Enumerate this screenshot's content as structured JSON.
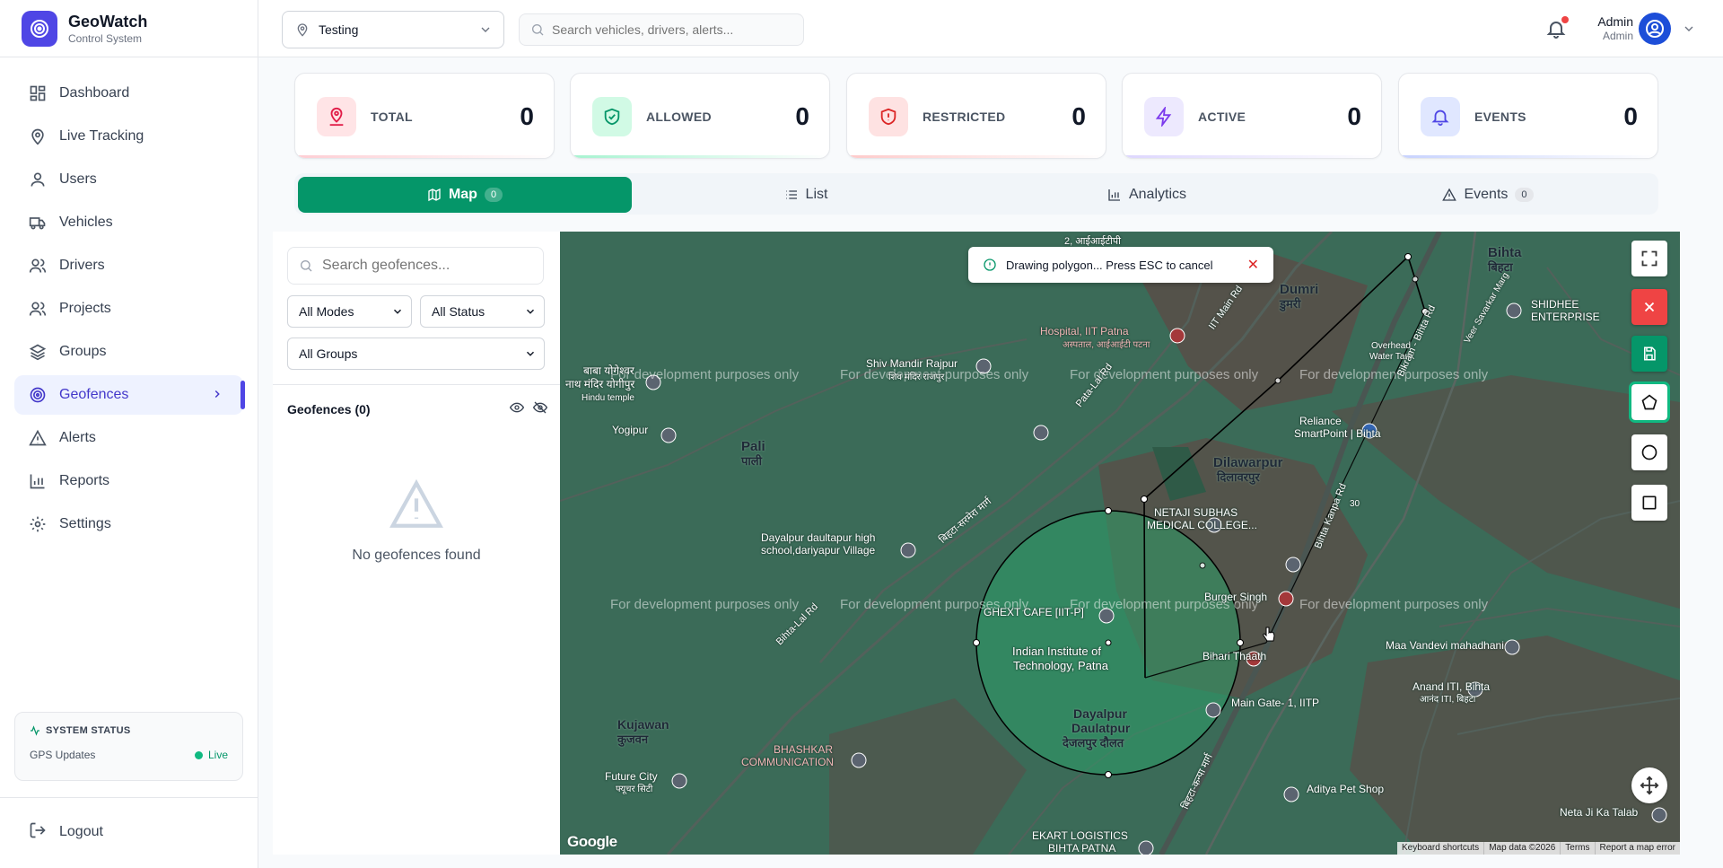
{
  "brand": {
    "name": "GeoWatch",
    "subtitle": "Control System"
  },
  "sidebar": {
    "items": [
      {
        "label": "Dashboard",
        "icon": "dashboard-icon"
      },
      {
        "label": "Live Tracking",
        "icon": "map-pin-icon"
      },
      {
        "label": "Users",
        "icon": "user-icon"
      },
      {
        "label": "Vehicles",
        "icon": "truck-icon"
      },
      {
        "label": "Drivers",
        "icon": "users-icon"
      },
      {
        "label": "Projects",
        "icon": "users-icon"
      },
      {
        "label": "Groups",
        "icon": "layers-icon"
      },
      {
        "label": "Geofences",
        "icon": "target-icon",
        "active": true
      },
      {
        "label": "Alerts",
        "icon": "warning-icon"
      },
      {
        "label": "Reports",
        "icon": "bar-chart-icon"
      },
      {
        "label": "Settings",
        "icon": "gear-icon"
      }
    ],
    "system_status": {
      "title": "SYSTEM STATUS",
      "label": "GPS Updates",
      "value": "Live"
    },
    "logout": "Logout"
  },
  "header": {
    "project": "Testing",
    "search_placeholder": "Search vehicles, drivers, alerts...",
    "user": {
      "name": "Admin",
      "role": "Admin"
    }
  },
  "stats": [
    {
      "label": "TOTAL",
      "value": "0",
      "color": "#e11d48"
    },
    {
      "label": "ALLOWED",
      "value": "0",
      "color": "#059669"
    },
    {
      "label": "RESTRICTED",
      "value": "0",
      "color": "#dc2626"
    },
    {
      "label": "ACTIVE",
      "value": "0",
      "color": "#7c3aed"
    },
    {
      "label": "EVENTS",
      "value": "0",
      "color": "#4f46e5"
    }
  ],
  "tabs": [
    {
      "label": "Map",
      "count": "0",
      "active": true
    },
    {
      "label": "List"
    },
    {
      "label": "Analytics"
    },
    {
      "label": "Events",
      "count": "0"
    }
  ],
  "panel": {
    "search_placeholder": "Search geofences...",
    "mode_filter": "All Modes",
    "status_filter": "All Status",
    "group_filter": "All Groups",
    "geofences_header": "Geofences (0)",
    "empty_text": "No geofences found"
  },
  "map": {
    "toast": "Drawing polygon... Press ESC to cancel",
    "watermark": "For development purposes only",
    "labels": {
      "bihta": "Bihta",
      "bihta_hi": "बिहटा",
      "dumri": "Dumri",
      "dumri_hi": "डुमरी",
      "hospital": "Hospital, IIT Patna",
      "hospital_hi": "अस्पताल, आईआईटी पटना",
      "shiv_mandir": "Shiv Mandir Rajpur",
      "shiv_mandir_hi": "शिव मंदिर राजपुर",
      "baba": "बाबा योगेश्वर",
      "baba2": "नाथ मंदिर योगीपुर",
      "yogipur": "Yogipur",
      "yogipur_hi": "Hindu temple",
      "pali": "Pali",
      "pali_hi": "पाली",
      "dilawarpur": "Dilawarpur",
      "dilawarpur_hi": "दिलावरपुर",
      "netaji": "NETAJI SUBHAS",
      "netaji2": "MEDICAL COLLEGE...",
      "dayalpur_school": "Dayalpur daultapur high",
      "dayalpur_school2": "school,dariyapur Village",
      "ghext": "GHEXT CAFE [IIT-P]",
      "iit": "Indian Institute of",
      "iit2": "Technology, Patna",
      "dayalpur": "Dayalpur",
      "dayalpur2": "Daulatpur",
      "dayalpur_hi": "देजलपुर दौलत",
      "bihari_thaath": "Bihari Thaath",
      "burger": "Burger Singh",
      "main_gate": "Main Gate- 1, IITP",
      "kujawan": "Kujawan",
      "kujawan_hi": "कुजवन",
      "bhashkar": "BHASHKAR",
      "bhashkar2": "COMMUNICATION",
      "future_city": "Future City",
      "future_city_hi": "फ्यूचर सिटी",
      "ekart": "EKART LOGISTICS",
      "ekart2": "BIHTA PATNA",
      "aditya": "Aditya Pet Shop",
      "maa": "Maa Vandevi mahadhani",
      "anand": "Anand ITI, Bihta",
      "anand_hi": "आनंद ITI, बिहटा",
      "neta": "Neta Ji Ka Talab",
      "reliance": "Reliance",
      "smartpoint": "SmartPoint | Bihta",
      "shidhee": "SHIDHEE",
      "shidhee2": "ENTERPRISE",
      "overhead": "Overhead",
      "overhead2": "Water Tank",
      "iit_main": "IIT Main Rd",
      "patna_lal": "Pata-Lal Rd",
      "bihta_road": "बिहटा-सरमेरा मार्ग",
      "bikram": "Bikram - Bihta Rd",
      "bihta_kanpa": "Bihta Kanpa Rd",
      "veer": "Veer Savarkar Marg",
      "bihta_lal": "Bihta-Lal Rd",
      "bihta_kanpa_hi": "बिहटा-कन्पा मार्ग",
      "top_label": "2, आईआईटीपी",
      "road_30": "30"
    },
    "attribution": [
      "Keyboard shortcuts",
      "Map data ©2026",
      "Terms",
      "Report a map error"
    ],
    "google": "Google"
  }
}
